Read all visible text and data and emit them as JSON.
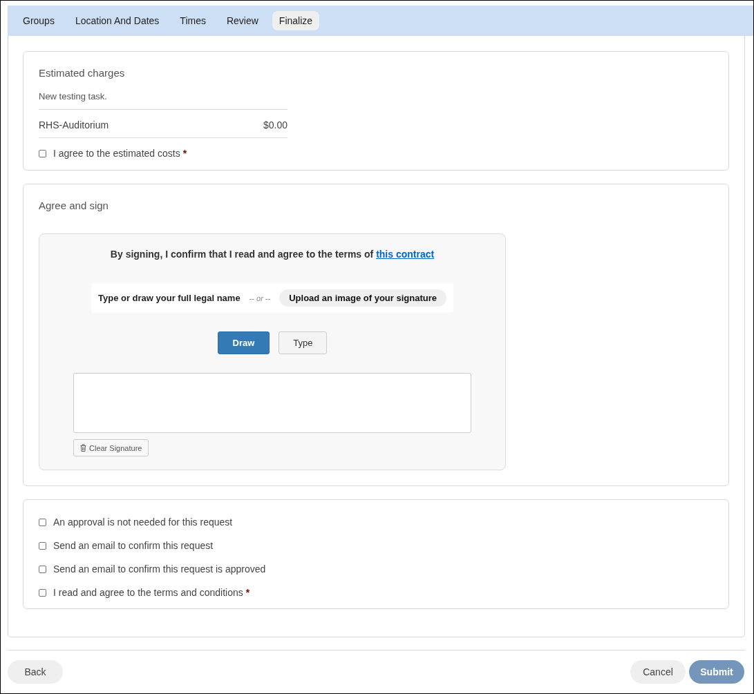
{
  "tabs": [
    {
      "label": "Groups",
      "selected": false
    },
    {
      "label": "Location And Dates",
      "selected": false
    },
    {
      "label": "Times",
      "selected": false
    },
    {
      "label": "Review",
      "selected": false
    },
    {
      "label": "Finalize",
      "selected": true
    }
  ],
  "estimated_charges": {
    "title": "Estimated charges",
    "description": "New testing task.",
    "items": [
      {
        "name": "RHS-Auditorium",
        "amount": "$0.00"
      }
    ],
    "agree": {
      "label": "I agree to the estimated costs",
      "checked": false,
      "mark": "*"
    }
  },
  "agree_and_sign": {
    "title": "Agree and sign",
    "statement": "By signing, I confirm that I read and agree to the terms of",
    "link": "this contract",
    "name_prompt": "Type or draw your full legal name",
    "separator": "-- or --",
    "upload_button": "Upload an image of your signature",
    "modes": [
      {
        "label": "Draw",
        "selected": true
      },
      {
        "label": "Type",
        "selected": false
      }
    ],
    "clear_button": "Clear Signature"
  },
  "options": [
    {
      "label": "An approval is not needed for this request",
      "checked": false
    },
    {
      "label": "Send an email to confirm this request",
      "checked": false
    },
    {
      "label": "Send an email to confirm this request is approved",
      "checked": false
    },
    {
      "label": "I read and agree to the terms and conditions",
      "checked": false,
      "mark": "*"
    }
  ],
  "footer": {
    "back": "Back",
    "cancel": "Cancel",
    "submit": {
      "label": "Submit",
      "disabled": true
    }
  }
}
